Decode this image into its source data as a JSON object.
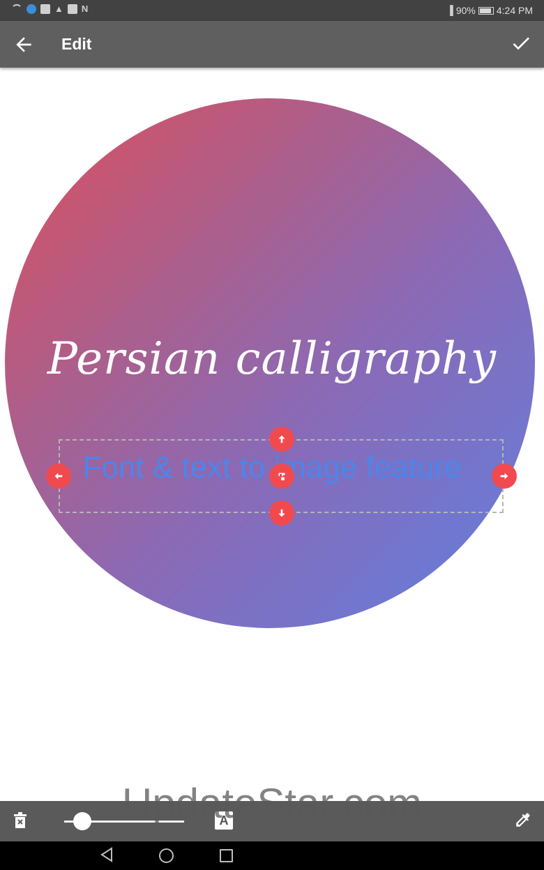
{
  "status_bar": {
    "battery_percent": "90%",
    "time": "4:24 PM",
    "icons": [
      "wifi-icon",
      "sync-icon",
      "image-icon",
      "notification-bell-icon",
      "image-icon",
      "n-icon",
      "vibrate-icon",
      "battery-icon"
    ],
    "battery_level": 0.9
  },
  "app_bar": {
    "title": "Edit",
    "back_icon": "arrow-back-icon",
    "confirm_icon": "check-icon"
  },
  "canvas": {
    "background_gradient": [
      "#de4f5c",
      "#5f80e0"
    ],
    "calligraphy_text": "Persian calligraphy",
    "selected_text": "Font & text to image feature",
    "selected_text_color": "#4a86ec",
    "handle_color": "#f04a4f"
  },
  "toolbar": {
    "delete_icon": "trash-icon",
    "size_slider_level": 0.15,
    "font_icon": "font-A-icon",
    "font_label": "A",
    "color_picker_icon": "eyedropper-icon"
  },
  "watermark": "UpdateStar.com",
  "nav_bar": {
    "icons": [
      "back-triangle-icon",
      "home-circle-icon",
      "recents-square-icon"
    ]
  }
}
